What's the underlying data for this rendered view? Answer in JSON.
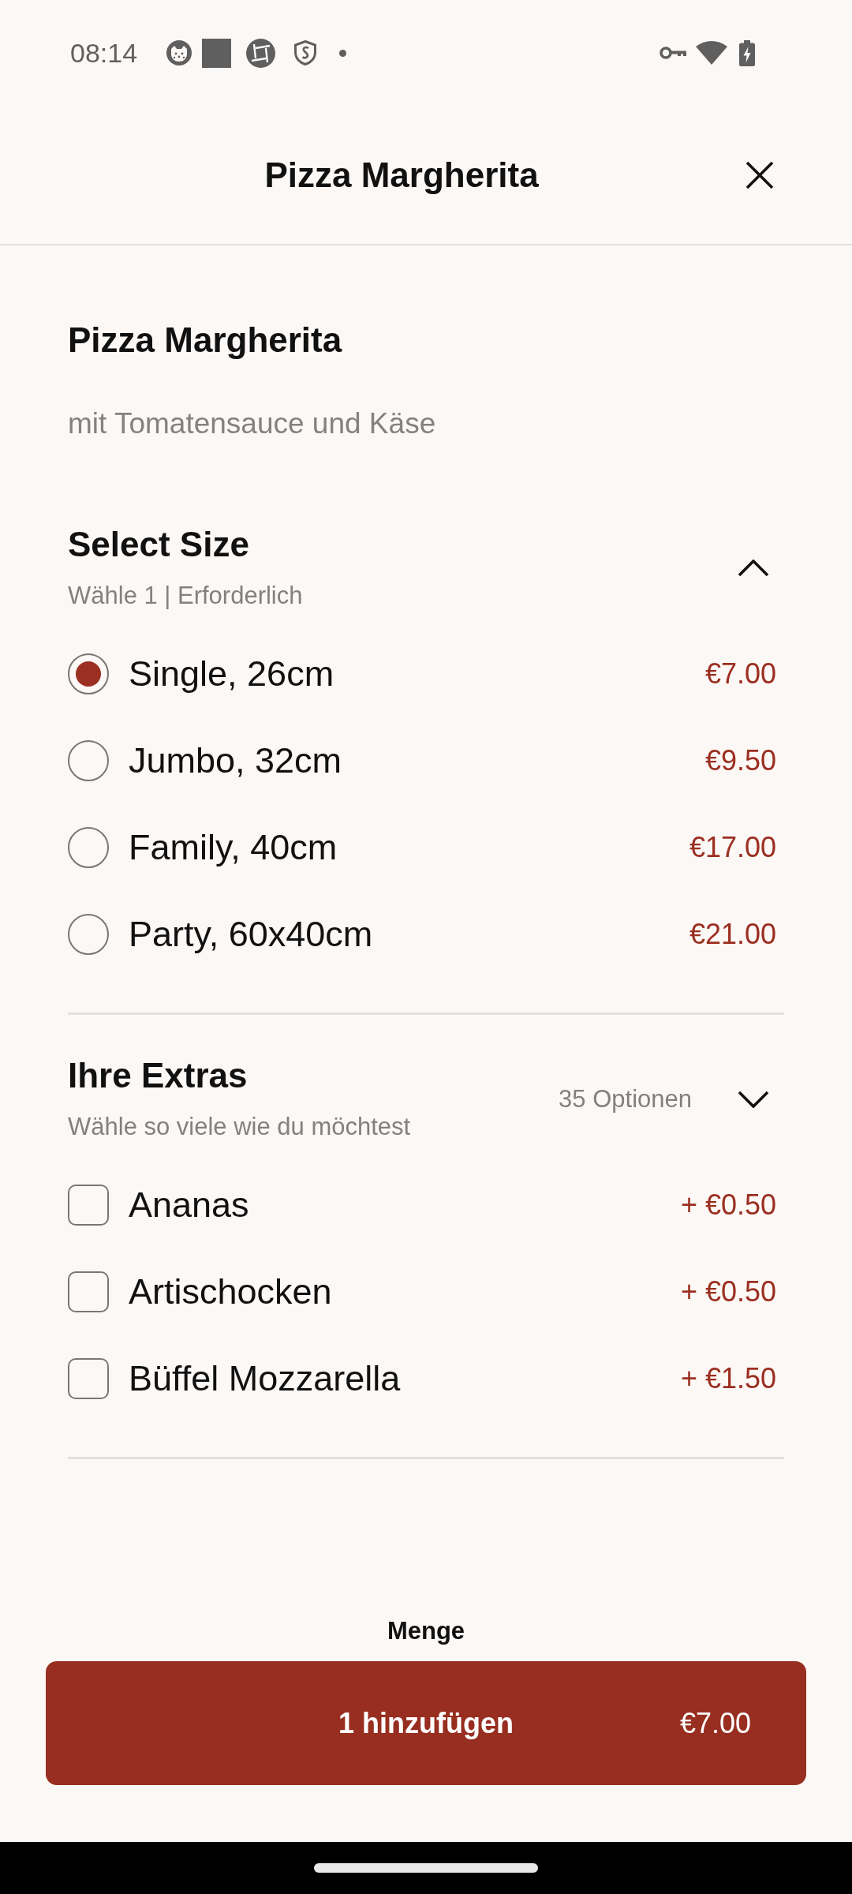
{
  "status_bar": {
    "time": "08:14"
  },
  "header": {
    "title": "Pizza Margherita"
  },
  "product": {
    "name": "Pizza Margherita",
    "description": "mit Tomatensauce und Käse"
  },
  "sections": [
    {
      "kind": "radio",
      "title": "Select Size",
      "subtitle": "Wähle 1 | Erforderlich",
      "expanded": true,
      "options": [
        {
          "label": "Single, 26cm",
          "price": "€7.00",
          "selected": true
        },
        {
          "label": "Jumbo, 32cm",
          "price": "€9.50",
          "selected": false
        },
        {
          "label": "Family, 40cm",
          "price": "€17.00",
          "selected": false
        },
        {
          "label": "Party, 60x40cm",
          "price": "€21.00",
          "selected": false
        }
      ]
    },
    {
      "kind": "checkbox",
      "title": "Ihre Extras",
      "subtitle": "Wähle so viele wie du möchtest",
      "count": "35 Optionen",
      "expanded": false,
      "options": [
        {
          "label": "Ananas",
          "price": "+ €0.50",
          "checked": false
        },
        {
          "label": "Artischocken",
          "price": "+ €0.50",
          "checked": false
        },
        {
          "label": "Büffel Mozzarella",
          "price": "+ €1.50",
          "checked": false
        }
      ]
    }
  ],
  "quantity_label": "Menge",
  "add_button": {
    "label": "1 hinzufügen",
    "price": "€7.00"
  }
}
